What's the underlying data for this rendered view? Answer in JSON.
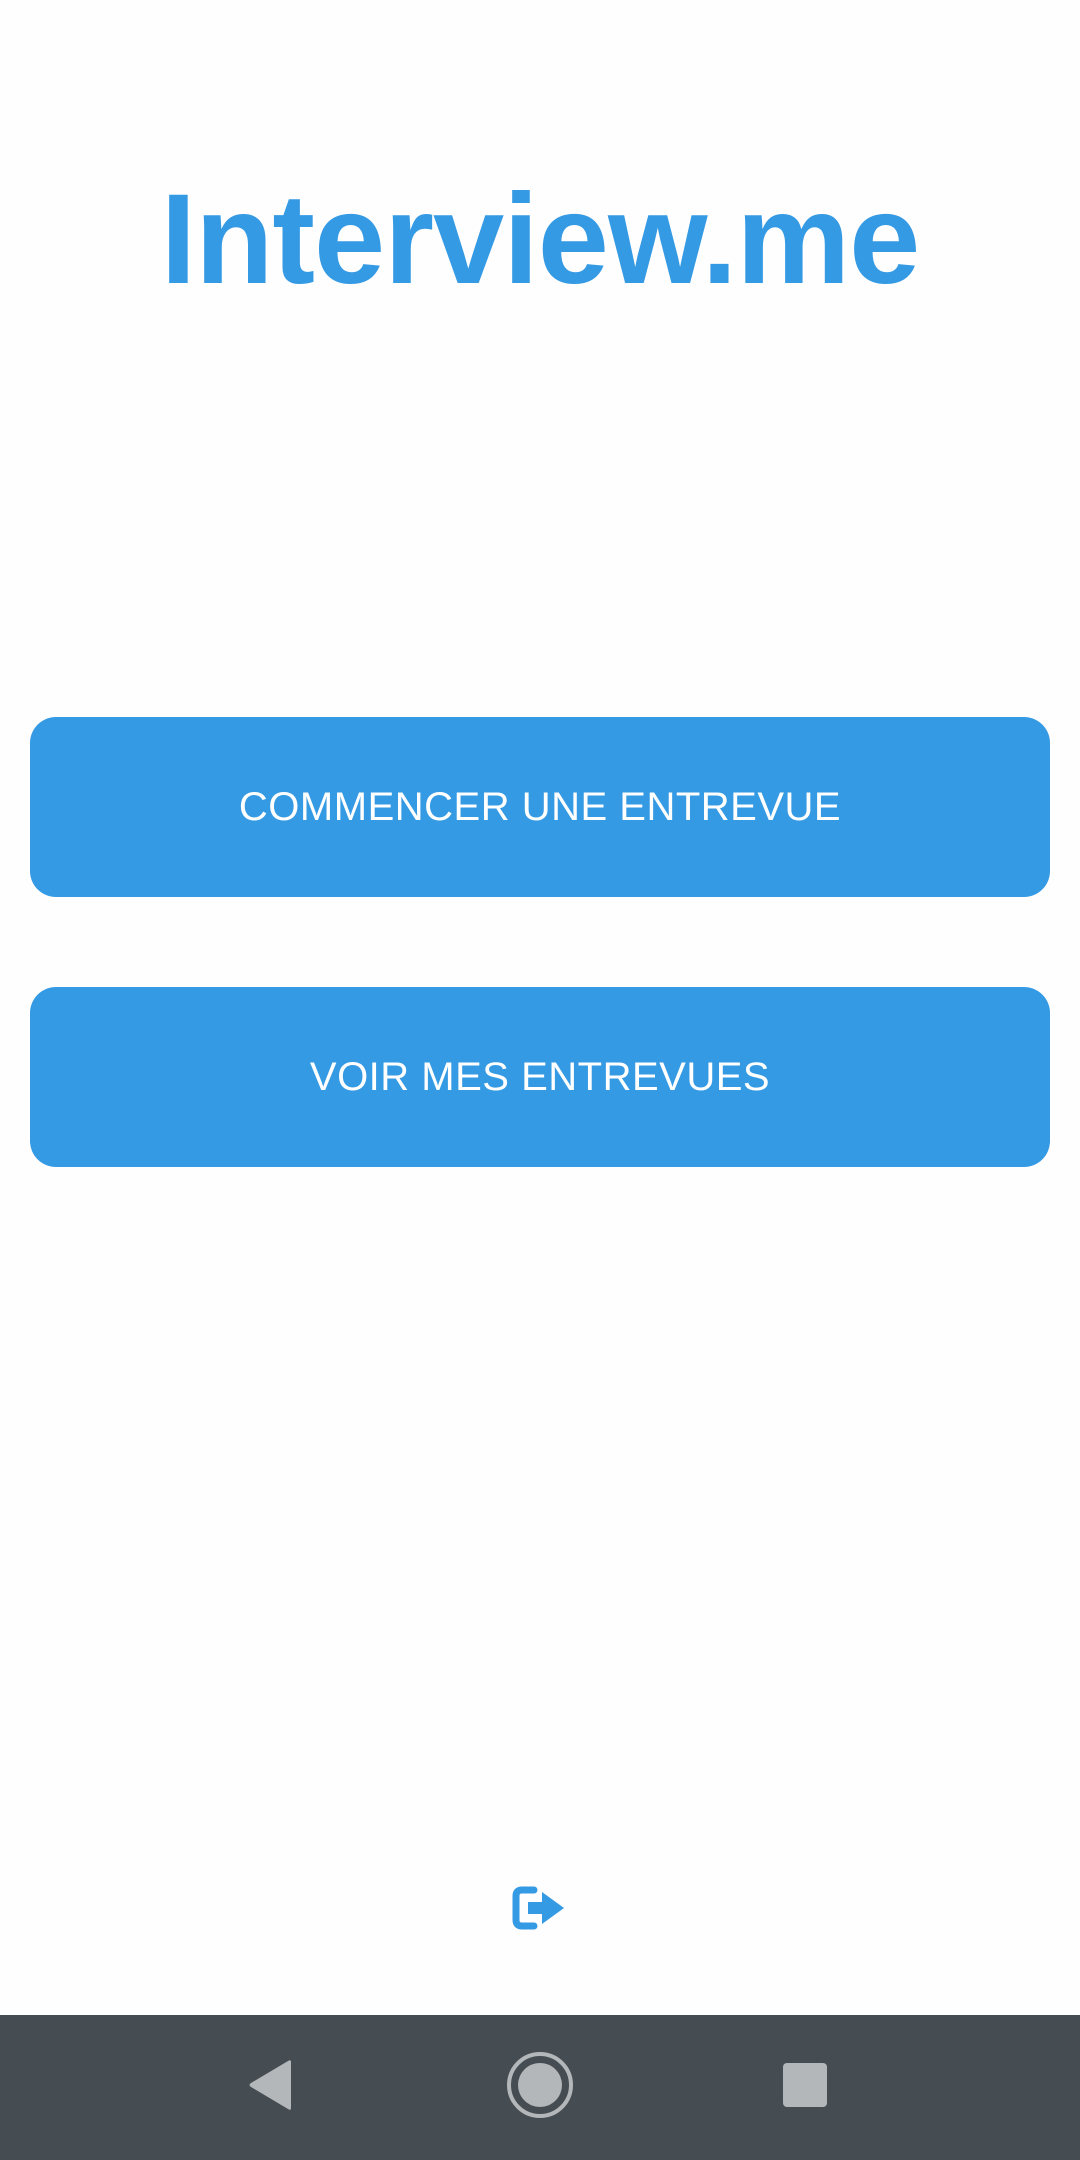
{
  "app": {
    "title": "Interview.me"
  },
  "actions": {
    "start_interview_label": "COMMENCER UNE ENTREVUE",
    "view_interviews_label": "VOIR MES ENTREVUES"
  },
  "icons": {
    "logout": "logout-icon",
    "nav_back": "back-triangle-icon",
    "nav_home": "home-circle-icon",
    "nav_recent": "recent-square-icon"
  },
  "colors": {
    "accent": "#359ae4",
    "background": "#fefefe",
    "nav_bar": "#464d52",
    "nav_icons": "#b4b7b9"
  }
}
